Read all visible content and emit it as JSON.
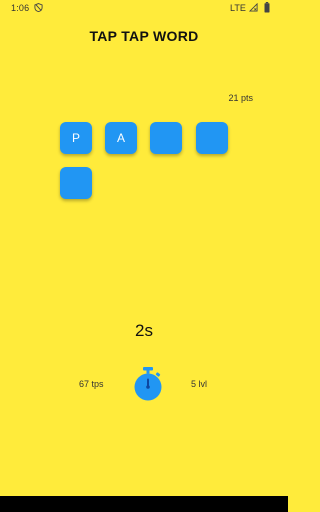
{
  "status_bar": {
    "time": "1:06",
    "network": "LTE",
    "icons": [
      "shield-icon",
      "signal-icon",
      "battery-icon"
    ]
  },
  "header": {
    "title": "TAP TAP WORD"
  },
  "score": {
    "points": "21 pts"
  },
  "tiles": [
    {
      "letter": "P"
    },
    {
      "letter": "A"
    },
    {
      "letter": ""
    },
    {
      "letter": ""
    },
    {
      "letter": ""
    }
  ],
  "timer": {
    "value": "2s"
  },
  "stats": {
    "tps": "67 tps",
    "level": "5 lvl",
    "center_icon": "stopwatch-icon"
  },
  "colors": {
    "background": "#ffeb3b",
    "tile": "#2196f3",
    "tile_text": "#ffffff",
    "stopwatch": "#2196f3"
  }
}
